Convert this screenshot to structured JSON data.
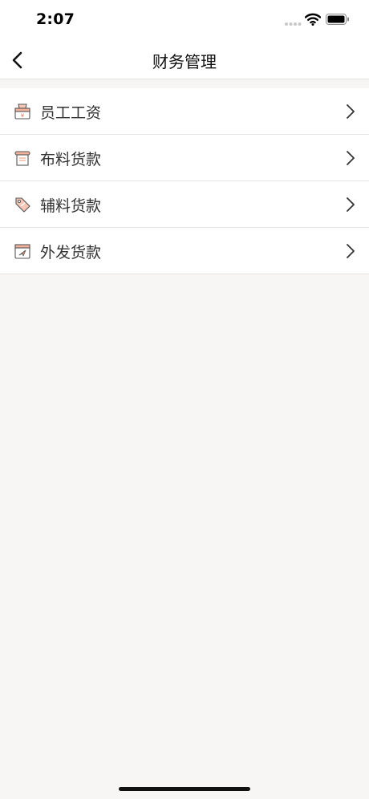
{
  "status_bar": {
    "time": "2:07"
  },
  "header": {
    "title": "财务管理"
  },
  "menu": {
    "items": [
      {
        "label": "员工工资",
        "icon": "wage-bag-icon"
      },
      {
        "label": "布料货款",
        "icon": "fabric-roll-icon"
      },
      {
        "label": "辅料货款",
        "icon": "price-tag-icon"
      },
      {
        "label": "外发货款",
        "icon": "outsource-send-icon"
      }
    ]
  },
  "colors": {
    "icon_accent": "#e8957a",
    "icon_stroke": "#555555",
    "page_background": "#f8f6f5"
  }
}
